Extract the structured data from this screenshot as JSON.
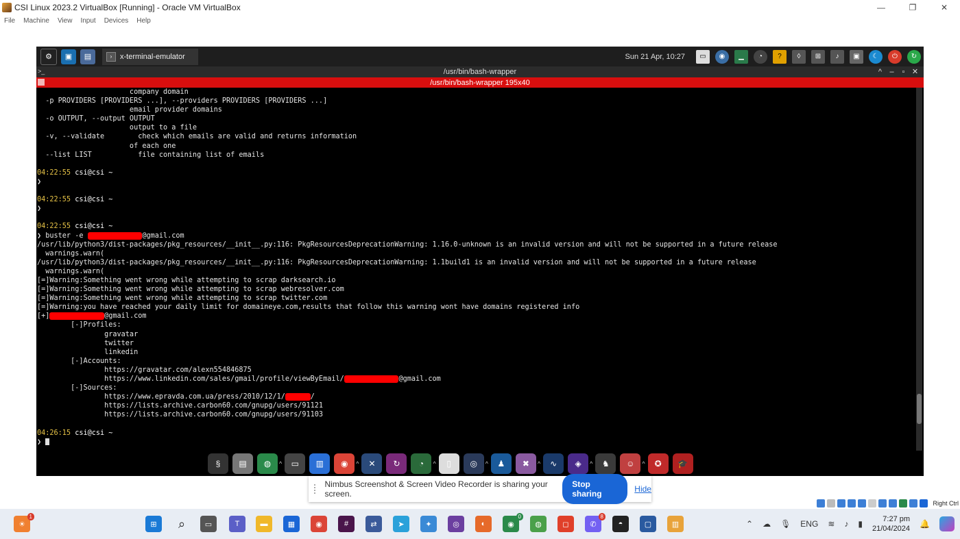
{
  "host_window": {
    "title": "CSI Linux 2023.2 VirtualBox [Running] - Oracle VM VirtualBox",
    "minimize": "—",
    "maximize": "❐",
    "close": "✕",
    "menu": [
      "File",
      "Machine",
      "View",
      "Input",
      "Devices",
      "Help"
    ]
  },
  "guest_panel": {
    "task_label": "x-terminal-emulator",
    "clock": "Sun 21 Apr, 10:27"
  },
  "terminal": {
    "title": "/usr/bin/bash-wrapper",
    "subtitle": "/usr/bin/bash-wrapper 195x40",
    "lines": [
      {
        "text": "                      company domain"
      },
      {
        "text": "  -p PROVIDERS [PROVIDERS ...], --providers PROVIDERS [PROVIDERS ...]"
      },
      {
        "text": "                      email provider domains"
      },
      {
        "text": "  -o OUTPUT, --output OUTPUT"
      },
      {
        "text": "                      output to a file"
      },
      {
        "text": "  -v, --validate        check which emails are valid and returns information"
      },
      {
        "text": "                      of each one"
      },
      {
        "text": "  --list LIST           file containing list of emails"
      },
      {
        "text": ""
      },
      {
        "prompt": {
          "time": "04:22:55",
          "user": " csi@csi ~"
        }
      },
      {
        "text": "❯"
      },
      {
        "text": ""
      },
      {
        "prompt": {
          "time": "04:22:55",
          "user": " csi@csi ~"
        }
      },
      {
        "text": "❯"
      },
      {
        "text": ""
      },
      {
        "prompt": {
          "time": "04:22:55",
          "user": " csi@csi ~"
        }
      },
      {
        "pre": "❯ buster -e ",
        "redacted": "xxxxxxxxxxxxx",
        "post": "@gmail.com"
      },
      {
        "text": "/usr/lib/python3/dist-packages/pkg_resources/__init__.py:116: PkgResourcesDeprecationWarning: 1.16.0-unknown is an invalid version and will not be supported in a future release"
      },
      {
        "text": "  warnings.warn("
      },
      {
        "text": "/usr/lib/python3/dist-packages/pkg_resources/__init__.py:116: PkgResourcesDeprecationWarning: 1.1build1 is an invalid version and will not be supported in a future release"
      },
      {
        "text": "  warnings.warn("
      },
      {
        "text": "[=]Warning:Something went wrong while attempting to scrap darksearch.io"
      },
      {
        "text": "[=]Warning:Something went wrong while attempting to scrap webresolver.com"
      },
      {
        "text": "[=]Warning:Something went wrong while attempting to scrap twitter.com"
      },
      {
        "text": "[=]Warning:you have reached your daily limit for domaineye.com,results that follow this warning wont have domains registered info"
      },
      {
        "pre": "[+]",
        "redacted": "xxxxxxxxxxxxx",
        "post": "@gmail.com"
      },
      {
        "text": "        [-]Profiles:"
      },
      {
        "text": "                gravatar"
      },
      {
        "text": "                twitter"
      },
      {
        "text": "                linkedin"
      },
      {
        "text": "        [-]Accounts:"
      },
      {
        "text": "                https://gravatar.com/alexn554846875"
      },
      {
        "pre": "                https://www.linkedin.com/sales/gmail/profile/viewByEmail/",
        "redacted": "xxxxxxxxxxxxx",
        "post": "@gmail.com"
      },
      {
        "text": "        [-]Sources:"
      },
      {
        "pre": "                https://www.epravda.com.ua/press/2010/12/1/",
        "redacted": "xxxxxx",
        "post": "/"
      },
      {
        "text": "                https://lists.archive.carbon60.com/gnupg/users/91121"
      },
      {
        "text": "                https://lists.archive.carbon60.com/gnupg/users/91103"
      },
      {
        "text": ""
      },
      {
        "prompt": {
          "time": "04:26:15",
          "user": " csi@csi ~"
        }
      },
      {
        "cursor": "❯ "
      }
    ],
    "scroll_fraction": 0.92
  },
  "dock_icons": [
    "csi-logo-icon",
    "drive-icon",
    "globe-icon",
    "terminal-icon",
    "document-icon",
    "chrome-icon",
    "grid-icon",
    "sync-icon",
    "clock-icon",
    "android-icon",
    "circles-icon",
    "penguin-icon",
    "x-icon",
    "wave-icon",
    "cube-icon",
    "dog-icon",
    "avatar-icon",
    "bird-icon",
    "grad-cap-icon"
  ],
  "share_banner": {
    "message": "Nimbus Screenshot & Screen Video Recorder is sharing your screen.",
    "stop_label": "Stop sharing",
    "hide_label": "Hide"
  },
  "vb_status": {
    "host_key": "Right Ctrl"
  },
  "win_taskbar": {
    "weather_badge": "1",
    "tray_lang": "ENG",
    "time": "7:27 pm",
    "date": "21/04/2024",
    "chrome_badge": "0",
    "viber_badge": "8"
  }
}
